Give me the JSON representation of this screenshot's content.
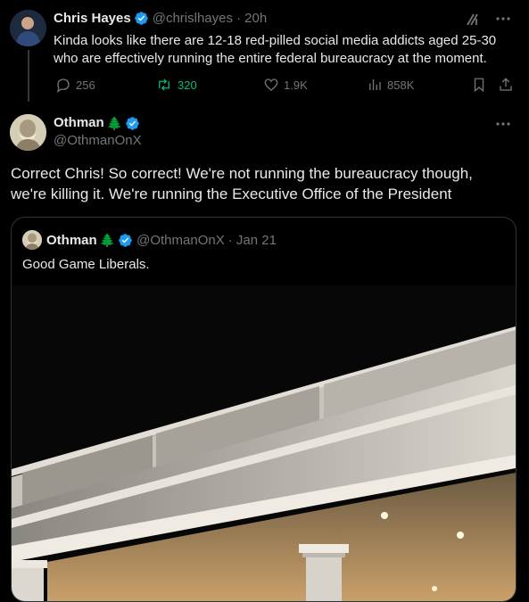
{
  "colors": {
    "background": "#000000",
    "text_primary": "#e7e9ea",
    "text_secondary": "#71767b",
    "verified_blue": "#1d9bf0",
    "repost_green": "#00ba7c",
    "border": "#2f3336"
  },
  "reply_tweet": {
    "author_name": "Chris Hayes",
    "handle": "@chrislhayes",
    "time": "· 20h",
    "text": "Kinda looks like there are 12-18 red-pilled social media addicts aged 25-30 who are effectively running the entire federal bureaucracy at the moment.",
    "stats": {
      "replies": "256",
      "reposts": "320",
      "likes": "1.9K",
      "views": "858K"
    }
  },
  "main_tweet": {
    "author_name": "Othman",
    "emoji": "🌲",
    "handle": "@OthmanOnX",
    "text": "Correct Chris! So correct! We're not running the bureaucracy though, we're killing it. We're running the Executive Office of the President"
  },
  "quoted_tweet": {
    "author_name": "Othman",
    "emoji": "🌲",
    "handle": "@OthmanOnX",
    "time": "· Jan 21",
    "text": "Good Game Liberals."
  }
}
